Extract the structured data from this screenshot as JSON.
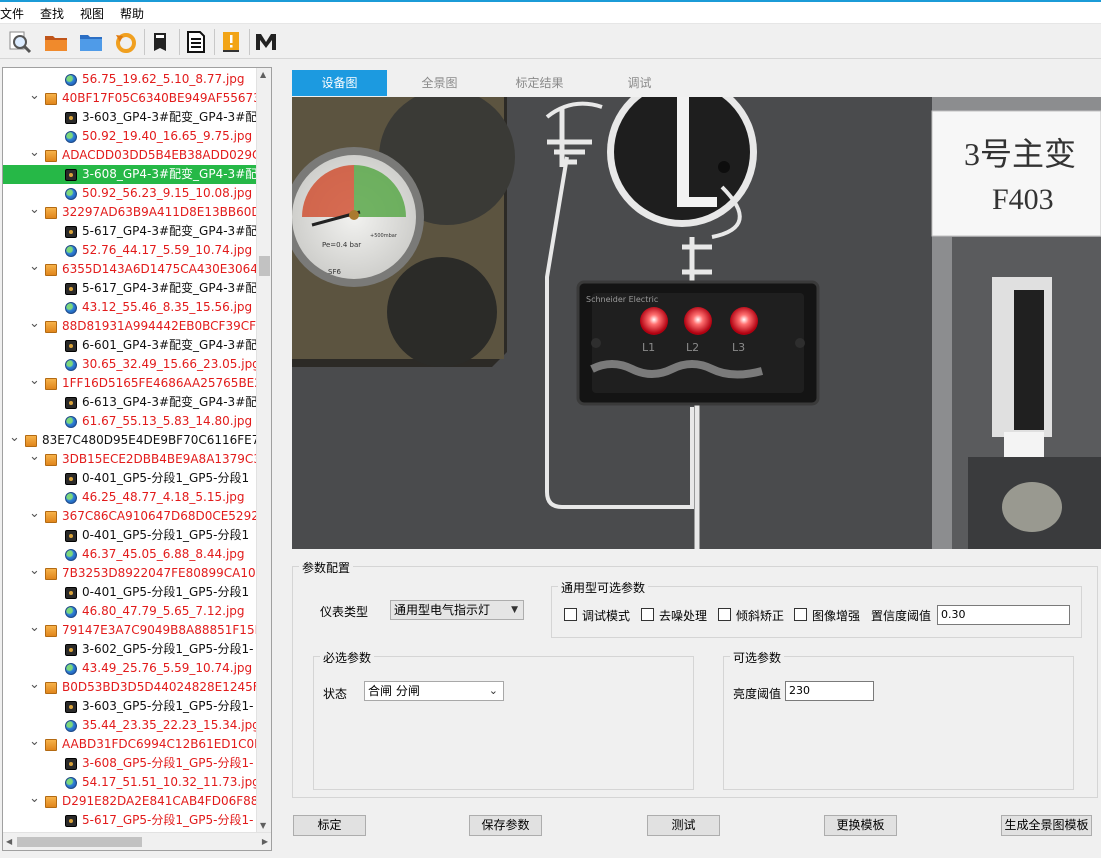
{
  "menu": [
    "文件",
    "查找",
    "视图",
    "帮助"
  ],
  "toolbar": [
    "magnifier-icon",
    "open-folder-icon",
    "folder-icon",
    "refresh-icon",
    "book-icon",
    "document-icon",
    "warning-icon",
    "m-icon"
  ],
  "tree": [
    {
      "level": 3,
      "icon": "globe",
      "text": "56.75_19.62_5.10_8.77.jpg",
      "color": "red"
    },
    {
      "level": 2,
      "icon": "folder",
      "text": "40BF17F05C6340BE949AF55673",
      "color": "red",
      "expanded": true
    },
    {
      "level": 3,
      "icon": "cam",
      "text": "3-603_GP4-3#配变_GP4-3#配",
      "color": "dark"
    },
    {
      "level": 3,
      "icon": "globe",
      "text": "50.92_19.40_16.65_9.75.jpg",
      "color": "red"
    },
    {
      "level": 2,
      "icon": "folder",
      "text": "ADACDD03DD5B4EB38ADD029C",
      "color": "red",
      "expanded": true
    },
    {
      "level": 3,
      "icon": "cam",
      "text": "3-608_GP4-3#配变_GP4-3#配",
      "color": "white",
      "selected": true
    },
    {
      "level": 3,
      "icon": "globe",
      "text": "50.92_56.23_9.15_10.08.jpg",
      "color": "red"
    },
    {
      "level": 2,
      "icon": "folder",
      "text": "32297AD63B9A411D8E13BB60D",
      "color": "red",
      "expanded": true
    },
    {
      "level": 3,
      "icon": "cam",
      "text": "5-617_GP4-3#配变_GP4-3#配",
      "color": "dark"
    },
    {
      "level": 3,
      "icon": "globe",
      "text": "52.76_44.17_5.59_10.74.jpg",
      "color": "red"
    },
    {
      "level": 2,
      "icon": "folder",
      "text": "6355D143A6D1475CA430E3064",
      "color": "red",
      "expanded": true
    },
    {
      "level": 3,
      "icon": "cam",
      "text": "5-617_GP4-3#配变_GP4-3#配",
      "color": "dark"
    },
    {
      "level": 3,
      "icon": "globe",
      "text": "43.12_55.46_8.35_15.56.jpg",
      "color": "red"
    },
    {
      "level": 2,
      "icon": "folder",
      "text": "88D81931A994442EB0BCF39CFE",
      "color": "red",
      "expanded": true
    },
    {
      "level": 3,
      "icon": "cam",
      "text": "6-601_GP4-3#配变_GP4-3#配",
      "color": "dark"
    },
    {
      "level": 3,
      "icon": "globe",
      "text": "30.65_32.49_15.66_23.05.jpg",
      "color": "red"
    },
    {
      "level": 2,
      "icon": "folder",
      "text": "1FF16D5165FE4686AA25765BE2",
      "color": "red",
      "expanded": true
    },
    {
      "level": 3,
      "icon": "cam",
      "text": "6-613_GP4-3#配变_GP4-3#配",
      "color": "dark"
    },
    {
      "level": 3,
      "icon": "globe",
      "text": "61.67_55.13_5.83_14.80.jpg",
      "color": "red"
    },
    {
      "level": 1,
      "icon": "folder",
      "text": "83E7C480D95E4DE9BF70C6116FE7D",
      "color": "dark",
      "expanded": true
    },
    {
      "level": 2,
      "icon": "folder",
      "text": "3DB15ECE2DBB4BE9A8A1379C3",
      "color": "red",
      "expanded": true
    },
    {
      "level": 3,
      "icon": "cam",
      "text": "0-401_GP5-分段1_GP5-分段1",
      "color": "dark"
    },
    {
      "level": 3,
      "icon": "globe",
      "text": "46.25_48.77_4.18_5.15.jpg",
      "color": "red"
    },
    {
      "level": 2,
      "icon": "folder",
      "text": "367C86CA910647D68D0CE5292",
      "color": "red",
      "expanded": true
    },
    {
      "level": 3,
      "icon": "cam",
      "text": "0-401_GP5-分段1_GP5-分段1",
      "color": "dark"
    },
    {
      "level": 3,
      "icon": "globe",
      "text": "46.37_45.05_6.88_8.44.jpg",
      "color": "red"
    },
    {
      "level": 2,
      "icon": "folder",
      "text": "7B3253D8922047FE80899CA106",
      "color": "red",
      "expanded": true
    },
    {
      "level": 3,
      "icon": "cam",
      "text": "0-401_GP5-分段1_GP5-分段1",
      "color": "dark"
    },
    {
      "level": 3,
      "icon": "globe",
      "text": "46.80_47.79_5.65_7.12.jpg",
      "color": "red"
    },
    {
      "level": 2,
      "icon": "folder",
      "text": "79147E3A7C9049B8A88851F15D",
      "color": "red",
      "expanded": true
    },
    {
      "level": 3,
      "icon": "cam",
      "text": "3-602_GP5-分段1_GP5-分段1-",
      "color": "dark"
    },
    {
      "level": 3,
      "icon": "globe",
      "text": "43.49_25.76_5.59_10.74.jpg",
      "color": "red"
    },
    {
      "level": 2,
      "icon": "folder",
      "text": "B0D53BD3D5D44024828E1245F",
      "color": "red",
      "expanded": true
    },
    {
      "level": 3,
      "icon": "cam",
      "text": "3-603_GP5-分段1_GP5-分段1-",
      "color": "dark"
    },
    {
      "level": 3,
      "icon": "globe",
      "text": "35.44_23.35_22.23_15.34.jpg",
      "color": "red"
    },
    {
      "level": 2,
      "icon": "folder",
      "text": "AABD31FDC6994C12B61ED1C0B",
      "color": "red",
      "expanded": true
    },
    {
      "level": 3,
      "icon": "cam",
      "text": "3-608_GP5-分段1_GP5-分段1-",
      "color": "red"
    },
    {
      "level": 3,
      "icon": "globe",
      "text": "54.17_51.51_10.32_11.73.jpg",
      "color": "red"
    },
    {
      "level": 2,
      "icon": "folder",
      "text": "D291E82DA2E841CAB4FD06F88E",
      "color": "red",
      "expanded": true
    },
    {
      "level": 3,
      "icon": "cam",
      "text": "5-617_GP5-分段1_GP5-分段1-",
      "color": "red"
    }
  ],
  "tabs": [
    {
      "label": "设备图",
      "active": true
    },
    {
      "label": "全景图"
    },
    {
      "label": "标定结果"
    },
    {
      "label": "调试"
    }
  ],
  "photo": {
    "sign_line1": "3号主变",
    "sign_line2": "F403",
    "gauge_text1": "Pe=0.4 bar",
    "gauge_text2": "+500mbar",
    "gauge_text3": "SF6",
    "brand": "Schneider Electric",
    "led_labels": [
      "L1",
      "L2",
      "L3"
    ]
  },
  "params": {
    "group_title": "参数配置",
    "meter_type_label": "仪表类型",
    "meter_type_value": "通用型电气指示灯",
    "optional_general_title": "通用型可选参数",
    "checkboxes": [
      "调试模式",
      "去噪处理",
      "倾斜矫正",
      "图像增强"
    ],
    "confidence_label": "置信度阈值",
    "confidence_value": "0.30",
    "required_title": "必选参数",
    "state_label": "状态",
    "state_value": "合闸 分闸",
    "optional_title": "可选参数",
    "brightness_label": "亮度阈值",
    "brightness_value": "230"
  },
  "buttons": [
    "标定",
    "保存参数",
    "测试",
    "更换模板",
    "生成全景图模板"
  ]
}
